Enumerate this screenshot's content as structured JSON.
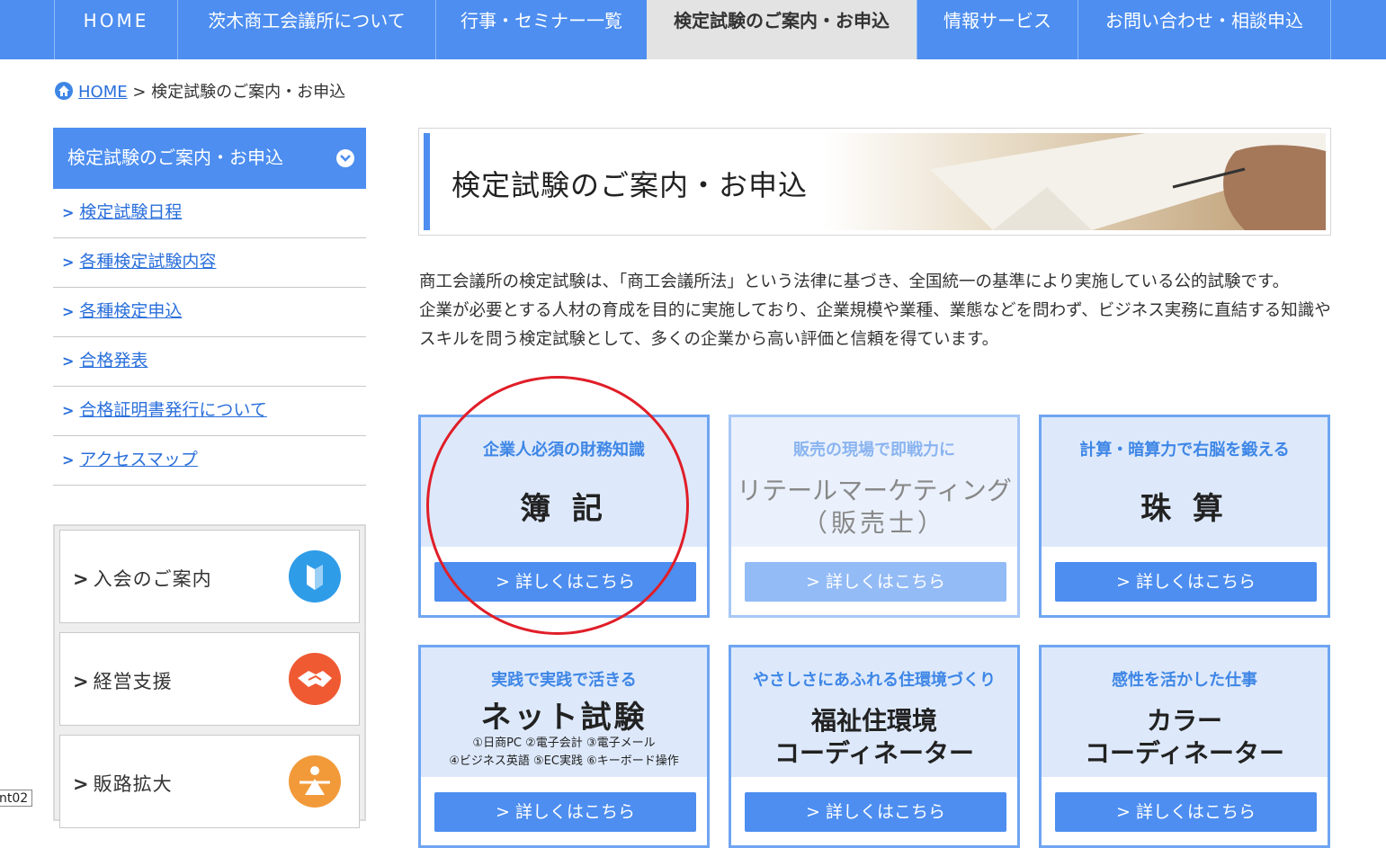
{
  "nav": {
    "items": [
      {
        "label": "HOME"
      },
      {
        "label": "茨木商工会議所について"
      },
      {
        "label": "行事・セミナー一覧"
      },
      {
        "label": "検定試験のご案内・お申込"
      },
      {
        "label": "情報サービス"
      },
      {
        "label": "お問い合わせ・相談申込"
      }
    ],
    "active_index": 3,
    "color": "#4d8ef0"
  },
  "breadcrumb": {
    "home": "HOME",
    "separator": ">",
    "current": "検定試験のご案内・お申込"
  },
  "sidebar": {
    "heading": "検定試験のご案内・お申込",
    "items": [
      {
        "label": "検定試験日程"
      },
      {
        "label": "各種検定試験内容"
      },
      {
        "label": "各種検定申込"
      },
      {
        "label": "合格発表"
      },
      {
        "label": "合格証明書発行について"
      },
      {
        "label": "アクセスマップ"
      }
    ],
    "banners": [
      {
        "label": "入会のご案内",
        "icon": "beginner-mark-icon"
      },
      {
        "label": "経営支援",
        "icon": "handshake-icon"
      },
      {
        "label": "販路拡大",
        "icon": "expansion-icon"
      }
    ]
  },
  "main": {
    "title": "検定試験のご案内・お申込",
    "intro": [
      "商工会議所の検定試験は、「商工会議所法」という法律に基づき、全国統一の基準により実施している公的試験です。",
      "企業が必要とする人材の育成を目的に実施しており、企業規模や業種、業態などを問わず、ビジネス実務に直結する知識やスキルを問う検定試験として、多くの企業から高い評価と信頼を得ています。"
    ],
    "cards": [
      {
        "subtitle": "企業人必須の財務知識",
        "name": "簿 記",
        "button": "詳しくはこちら",
        "dimmed": false
      },
      {
        "subtitle": "販売の現場で即戦力に",
        "name_line1": "リテールマーケティング",
        "name_line2": "（販売士）",
        "button": "詳しくはこちら",
        "dimmed": true
      },
      {
        "subtitle": "計算・暗算力で右脳を鍛える",
        "name": "珠 算",
        "button": "詳しくはこちら",
        "dimmed": false
      },
      {
        "subtitle": "実践で実践で活きる",
        "name": "ネット試験",
        "detail_line1": "①日商PC ②電子会計 ③電子メール",
        "detail_line2": "④ビジネス英語 ⑤EC実践 ⑥キーボード操作",
        "button": "詳しくはこちら",
        "dimmed": false
      },
      {
        "subtitle": "やさしさにあふれる住環境づくり",
        "name_line1": "福祉住環境",
        "name_line2": "コーディネーター",
        "button": "詳しくはこちら",
        "dimmed": false
      },
      {
        "subtitle": "感性を活かした仕事",
        "name_line1": "カラー",
        "name_line2": "コーディネーター",
        "button": "詳しくはこちら",
        "dimmed": false
      }
    ],
    "button_arrow": ">"
  },
  "corner_tag": "nt02",
  "colors": {
    "accent": "#4d8ef0",
    "link": "#2a6fdb",
    "annotation_circle": "#e01e28"
  }
}
